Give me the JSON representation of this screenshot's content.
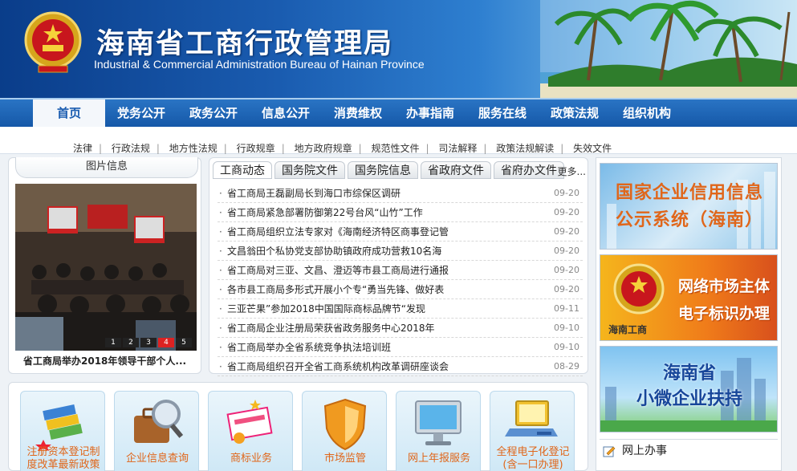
{
  "header": {
    "title_cn": "海南省工商行政管理局",
    "title_en": "Industrial & Commercial Administration Bureau of Hainan Province",
    "emblem_icon": "national-emblem-icon"
  },
  "nav": {
    "items": [
      "首页",
      "党务公开",
      "政务公开",
      "信息公开",
      "消费维权",
      "办事指南",
      "服务在线",
      "政策法规",
      "组织机构"
    ],
    "active_index": 0
  },
  "subnav": {
    "links": [
      "法律",
      "行政法规",
      "地方性法规",
      "行政规章",
      "地方政府规章",
      "规范性文件",
      "司法解释",
      "政策法规解读",
      "失效文件"
    ]
  },
  "photo": {
    "tab_label": "图片信息",
    "caption": "省工商局举办2018年领导干部个人...",
    "pager": [
      "1",
      "2",
      "3",
      "4",
      "5"
    ],
    "active_page": 3
  },
  "news": {
    "tabs": [
      "工商动态",
      "国务院文件",
      "国务院信息",
      "省政府文件",
      "省府办文件"
    ],
    "more": "更多...",
    "items": [
      {
        "text": "省工商局王磊副局长到海口市综保区调研",
        "date": "09-20"
      },
      {
        "text": "省工商局紧急部署防御第22号台风“山竹”工作",
        "date": "09-20"
      },
      {
        "text": "省工商局组织立法专家对《海南经济特区商事登记管",
        "date": "09-20"
      },
      {
        "text": "文昌翁田个私协党支部协助镇政府成功营救10名海",
        "date": "09-20"
      },
      {
        "text": "省工商局对三亚、文昌、澄迈等市县工商局进行通报",
        "date": "09-20"
      },
      {
        "text": "各市县工商局多形式开展小个专“勇当先锋、做好表",
        "date": "09-20"
      },
      {
        "text": "三亚芒果”参加2018中国国际商标品牌节“发现",
        "date": "09-11"
      },
      {
        "text": "省工商局企业注册局荣获省政务服务中心2018年",
        "date": "09-10"
      },
      {
        "text": "省工商局举办全省系统竞争执法培训班",
        "date": "09-10"
      },
      {
        "text": "省工商局组织召开全省工商系统机构改革调研座谈会",
        "date": "08-29"
      }
    ]
  },
  "banners": {
    "b1": [
      "国家企业信用信息",
      "公示系统（海南）"
    ],
    "b2": [
      "网络市场主体",
      "电子标识办理"
    ],
    "b2_small": "海南工商",
    "b3": [
      "海南省",
      "小微企业扶持"
    ],
    "online_service": "网上办事"
  },
  "services": [
    {
      "label1": "注册资本登记制",
      "label2": "度改革最新政策",
      "icon": "books-icon"
    },
    {
      "label1": "企业信息查询",
      "label2": "",
      "icon": "briefcase-search-icon"
    },
    {
      "label1": "商标业务",
      "label2": "",
      "icon": "trademark-certificate-icon"
    },
    {
      "label1": "市场监管",
      "label2": "",
      "icon": "shield-icon"
    },
    {
      "label1": "网上年报服务",
      "label2": "",
      "icon": "monitor-icon"
    },
    {
      "label1": "全程电子化登记",
      "label2": "(含一口办理)",
      "icon": "laptop-icon"
    }
  ]
}
